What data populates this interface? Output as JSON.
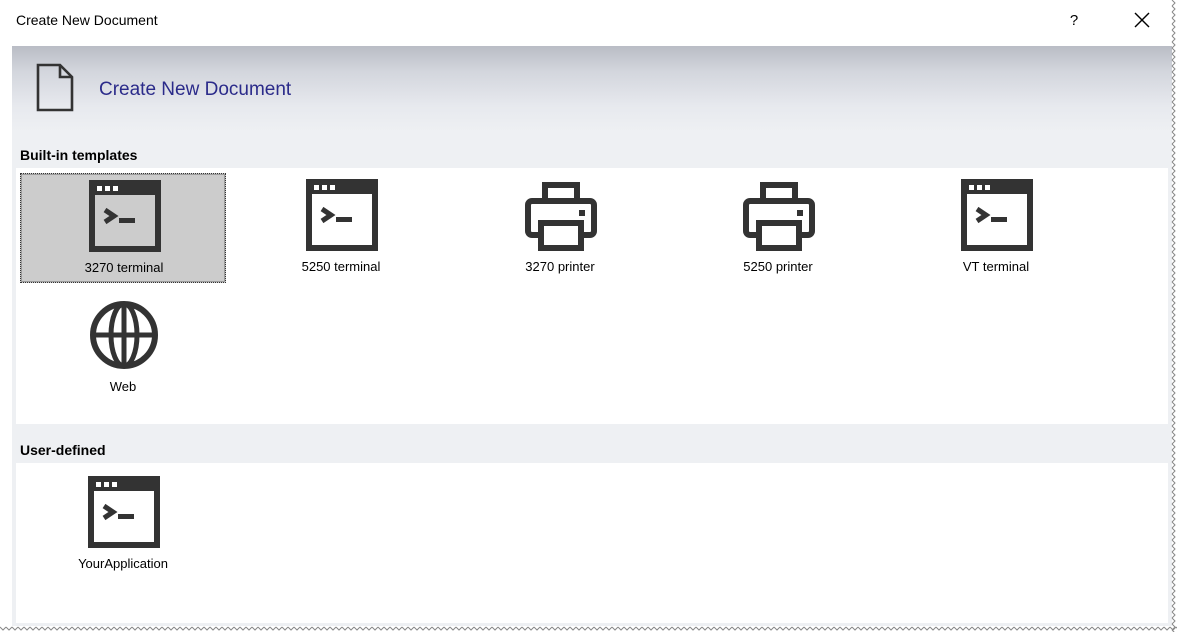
{
  "window": {
    "title": "Create New Document",
    "help_label": "?",
    "close_icon": "close-icon"
  },
  "header": {
    "title": "Create New Document",
    "icon": "document-icon"
  },
  "sections": {
    "builtin": {
      "label": "Built-in templates",
      "items": [
        {
          "label": "3270 terminal",
          "icon": "terminal-icon",
          "selected": true
        },
        {
          "label": "5250 terminal",
          "icon": "terminal-icon",
          "selected": false
        },
        {
          "label": "3270 printer",
          "icon": "printer-icon",
          "selected": false
        },
        {
          "label": "5250 printer",
          "icon": "printer-icon",
          "selected": false
        },
        {
          "label": "VT terminal",
          "icon": "terminal-icon",
          "selected": false
        },
        {
          "label": "Web",
          "icon": "globe-icon",
          "selected": false
        }
      ]
    },
    "user": {
      "label": "User-defined",
      "items": [
        {
          "label": "YourApplication",
          "icon": "terminal-icon",
          "selected": false
        }
      ]
    }
  },
  "colors": {
    "header_title": "#2b2b8a",
    "selection_bg": "#cccccc",
    "icon": "#333333"
  }
}
